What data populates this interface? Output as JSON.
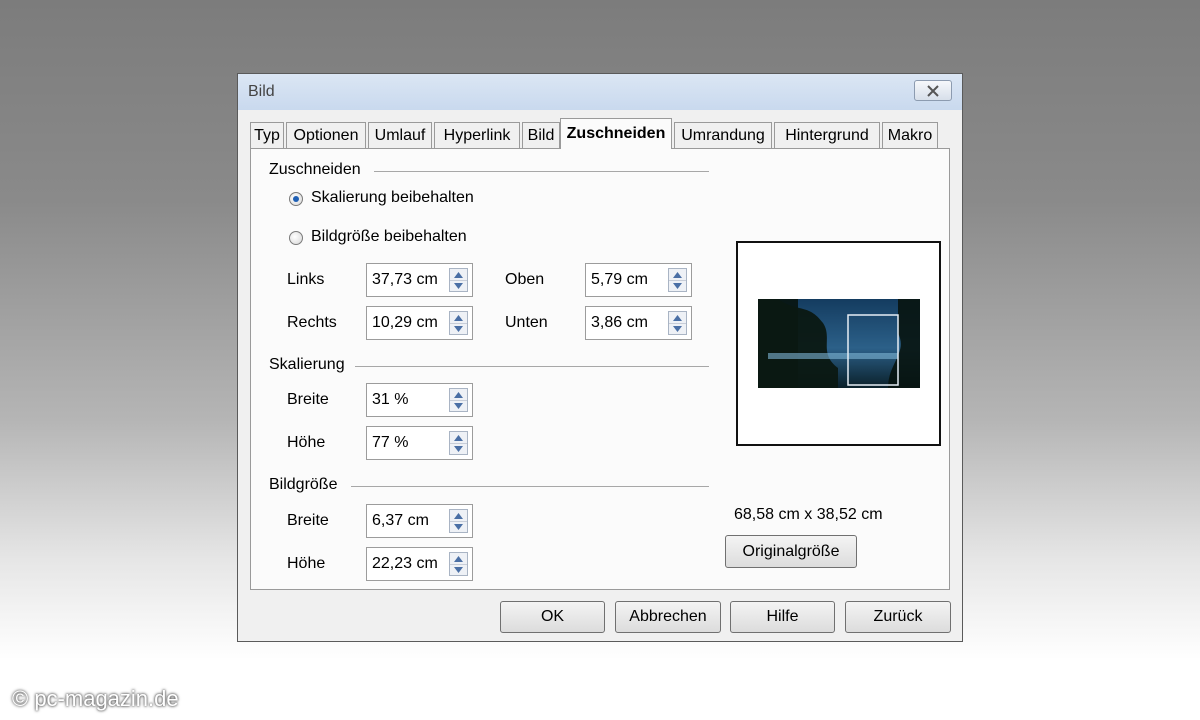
{
  "window": {
    "title": "Bild"
  },
  "tabs": [
    "Typ",
    "Optionen",
    "Umlauf",
    "Hyperlink",
    "Bild",
    "Zuschneiden",
    "Umrandung",
    "Hintergrund",
    "Makro"
  ],
  "active_tab": "Zuschneiden",
  "crop": {
    "section_title": "Zuschneiden",
    "radio_keep_scale": "Skalierung beibehalten",
    "radio_keep_size": "Bildgröße beibehalten",
    "selected": "Skalierung beibehalten",
    "left_label": "Links",
    "left_value": "37,73 cm",
    "right_label": "Rechts",
    "right_value": "10,29 cm",
    "top_label": "Oben",
    "top_value": "5,79 cm",
    "bottom_label": "Unten",
    "bottom_value": "3,86 cm"
  },
  "scale": {
    "section_title": "Skalierung",
    "width_label": "Breite",
    "width_value": "31 %",
    "height_label": "Höhe",
    "height_value": "77 %"
  },
  "size": {
    "section_title": "Bildgröße",
    "width_label": "Breite",
    "width_value": "6,37 cm",
    "height_label": "Höhe",
    "height_value": "22,23 cm"
  },
  "original": {
    "dimensions": "68,58 cm x 38,52 cm",
    "button_label": "Originalgröße"
  },
  "footer": {
    "ok": "OK",
    "cancel": "Abbrechen",
    "help": "Hilfe",
    "reset": "Zurück"
  },
  "watermark": "© pc-magazin.de",
  "colors": {
    "radio_selected": "#1e5fb4",
    "titlebar": "#c9d9ee"
  }
}
